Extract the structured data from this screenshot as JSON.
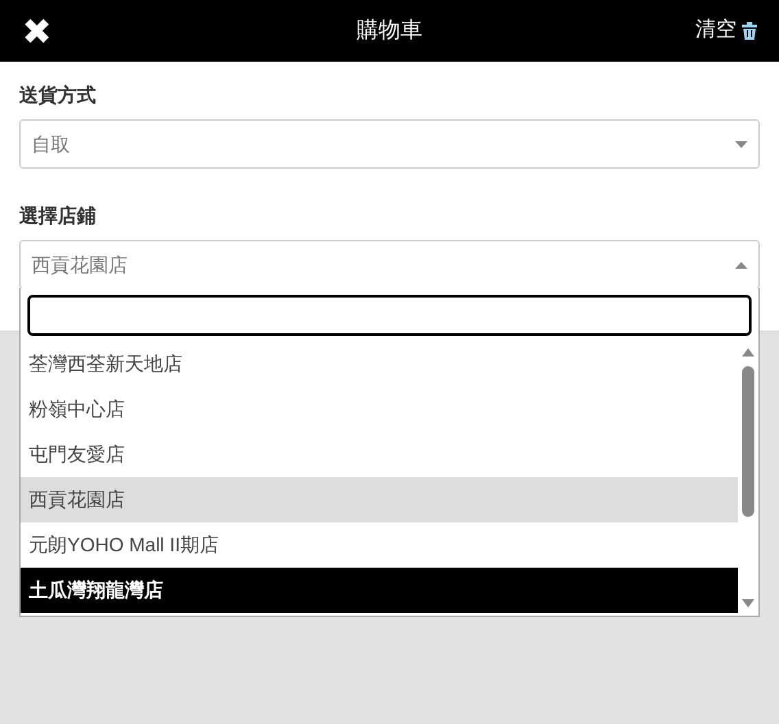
{
  "header": {
    "close_symbol": "✖",
    "title": "購物車",
    "clear_label": "清空"
  },
  "delivery": {
    "label": "送貨方式",
    "value": "自取"
  },
  "store": {
    "label": "選擇店鋪",
    "value": "西貢花園店",
    "expanded": true,
    "options": [
      {
        "label": "荃灣西荃新天地店",
        "selected": false,
        "highlighted": false
      },
      {
        "label": "粉嶺中心店",
        "selected": false,
        "highlighted": false
      },
      {
        "label": "屯門友愛店",
        "selected": false,
        "highlighted": false
      },
      {
        "label": "西貢花園店",
        "selected": true,
        "highlighted": false
      },
      {
        "label": "元朗YOHO Mall II期店",
        "selected": false,
        "highlighted": false
      },
      {
        "label": "土瓜灣翔龍灣店",
        "selected": false,
        "highlighted": true
      }
    ]
  }
}
